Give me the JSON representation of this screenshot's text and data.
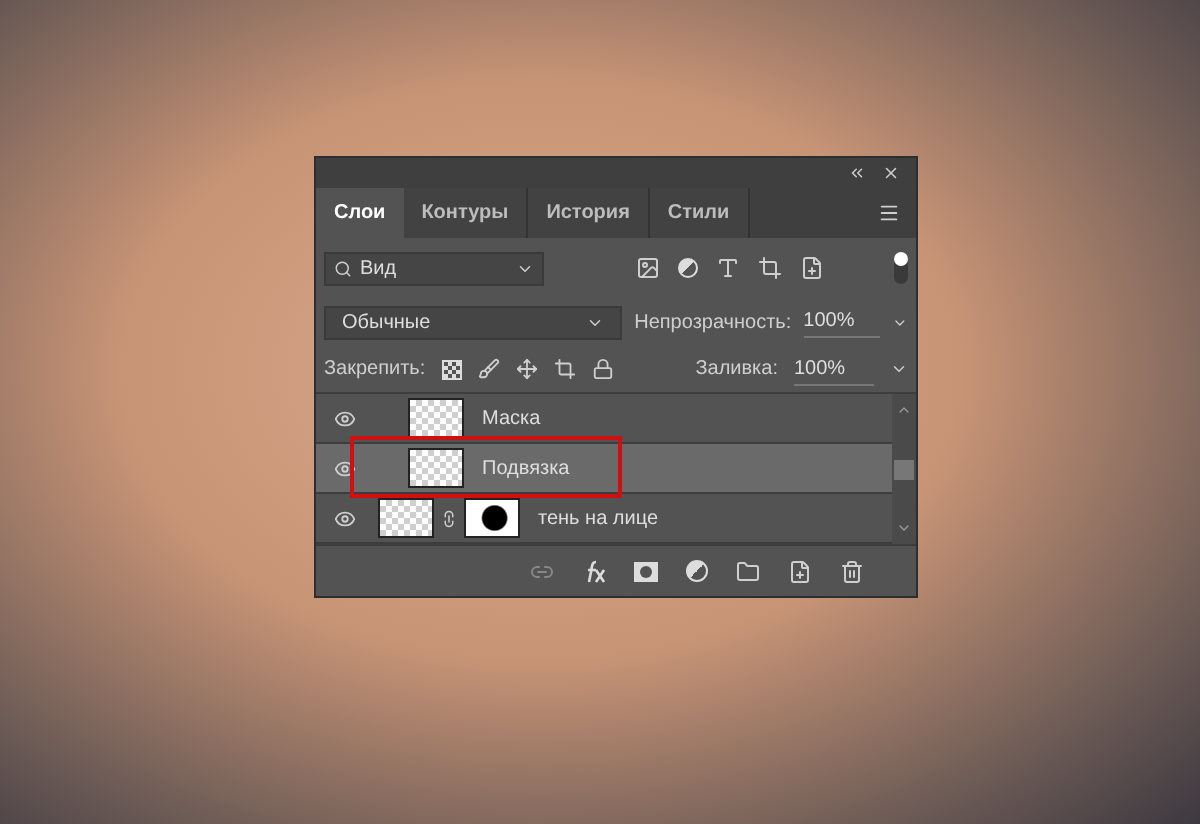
{
  "panel": {
    "tabs": [
      {
        "label": "Слои",
        "selected": true
      },
      {
        "label": "Контуры",
        "selected": false
      },
      {
        "label": "История",
        "selected": false
      },
      {
        "label": "Стили",
        "selected": false
      }
    ],
    "filter": {
      "value": "Вид"
    },
    "blend_mode": {
      "value": "Обычные"
    },
    "opacity": {
      "label": "Непрозрачность:",
      "value": "100%"
    },
    "lock": {
      "label": "Закрепить:"
    },
    "fill": {
      "label": "Заливка:",
      "value": "100%"
    },
    "layers": [
      {
        "name": "Маска",
        "kind": "clipped",
        "selected": false,
        "visible": true,
        "highlighted": false
      },
      {
        "name": "Подвязка",
        "kind": "clipped",
        "selected": true,
        "visible": true,
        "highlighted": true
      },
      {
        "name": "тень на лице",
        "kind": "masked",
        "selected": false,
        "visible": true,
        "highlighted": false
      }
    ]
  }
}
